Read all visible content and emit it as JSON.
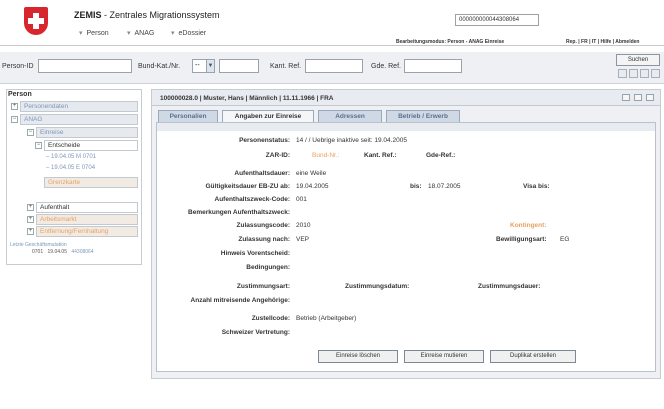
{
  "header": {
    "title_main": "ZEMIS",
    "title_sub": " - Zentrales Migrationssystem",
    "nav": [
      "Person",
      "ANAG",
      "eDossier"
    ],
    "case_number": "000000000044308064",
    "mode_line": "Bearbeitungsmodus: Person - ANAG Einreise",
    "lang_links": "Rep. | FR | IT | Hilfe | Abmelden"
  },
  "searchbar": {
    "person_id_label": "Person-ID",
    "bund_label": "Bund-Kat./Nr.",
    "bund_select_value": "--",
    "kant_label": "Kant. Ref.",
    "gde_label": "Gde. Ref.",
    "search_button": "Suchen"
  },
  "tree": {
    "title": "Person",
    "items": {
      "personendaten": "Personendaten",
      "anag": "ANAG",
      "einreise": "Einreise",
      "entscheide": "Entscheide",
      "entscheid_1": "19.04.05 M 0701",
      "entscheid_2": "19.04.05 E 0704",
      "grenzkarte": "Grenzkarte",
      "aufenthalt": "Aufenthalt",
      "arbeitsmarkt": "Arbeitsmarkt",
      "entfernung": "Entfernung/Fernhaltung"
    },
    "footer_title": "Letzte Geschäftsmutation",
    "footer_code": "0701",
    "footer_date": "19.04.05",
    "footer_link": "44308064"
  },
  "main": {
    "title": "100000028.0 | Muster, Hans | Männlich | 11.11.1966 | FRA",
    "tabs": [
      "Personalien",
      "Angaben zur Einreise",
      "Adressen",
      "Betrieb / Erwerb"
    ],
    "fields": {
      "personenstatus_label": "Personenstatus:",
      "personenstatus_value": "14 / / Uebrige inaktive  seit: 19.04.2005",
      "zar_label": "ZAR-ID:",
      "bund_nr_label": "Bund-Nr.:",
      "kant_ref_label": "Kant. Ref.:",
      "gde_ref_label": "Gde-Ref.:",
      "aufenthaltsdauer_label": "Aufenthaltsdauer:",
      "aufenthaltsdauer_value": "eine Weile",
      "gueltigkeit_label": "Gültigkeitsdauer EB-ZU ab:",
      "gueltigkeit_value": "19.04.2005",
      "bis_label": "bis:",
      "bis_value": "18.07.2005",
      "visa_label": "Visa bis:",
      "zweck_code_label": "Aufenthaltszweck-Code:",
      "zweck_code_value": "001",
      "bemerkungen_label": "Bemerkungen Aufenthaltszweck:",
      "zulassungscode_label": "Zulassungscode:",
      "zulassungscode_value": "2010",
      "kontingent_label": "Kontingent:",
      "zulassung_nach_label": "Zulassung nach:",
      "zulassung_nach_value": "VEP",
      "bewilligungsart_label": "Bewilligungsart:",
      "bewilligungsart_value": "EG",
      "hinweis_label": "Hinweis Vorentscheid:",
      "bedingungen_label": "Bedingungen:",
      "zustimmungsart_label": "Zustimmungsart:",
      "zustimmungsdatum_label": "Zustimmungsdatum:",
      "zustimmungsdauer_label": "Zustimmungsdauer:",
      "angehoerige_label": "Anzahl mitreisende Angehörige:",
      "zustellcode_label": "Zustellcode:",
      "zustellcode_value": "Betrieb (Arbeitgeber)",
      "vertretung_label": "Schweizer Vertretung:"
    },
    "buttons": {
      "delete": "Einreise löschen",
      "mutate": "Einreise mutieren",
      "duplicate": "Duplikat erstellen"
    }
  },
  "colors": {
    "accent_blue": "#7d98b8",
    "accent_orange": "#e8a060",
    "swiss_red": "#d8262e"
  }
}
